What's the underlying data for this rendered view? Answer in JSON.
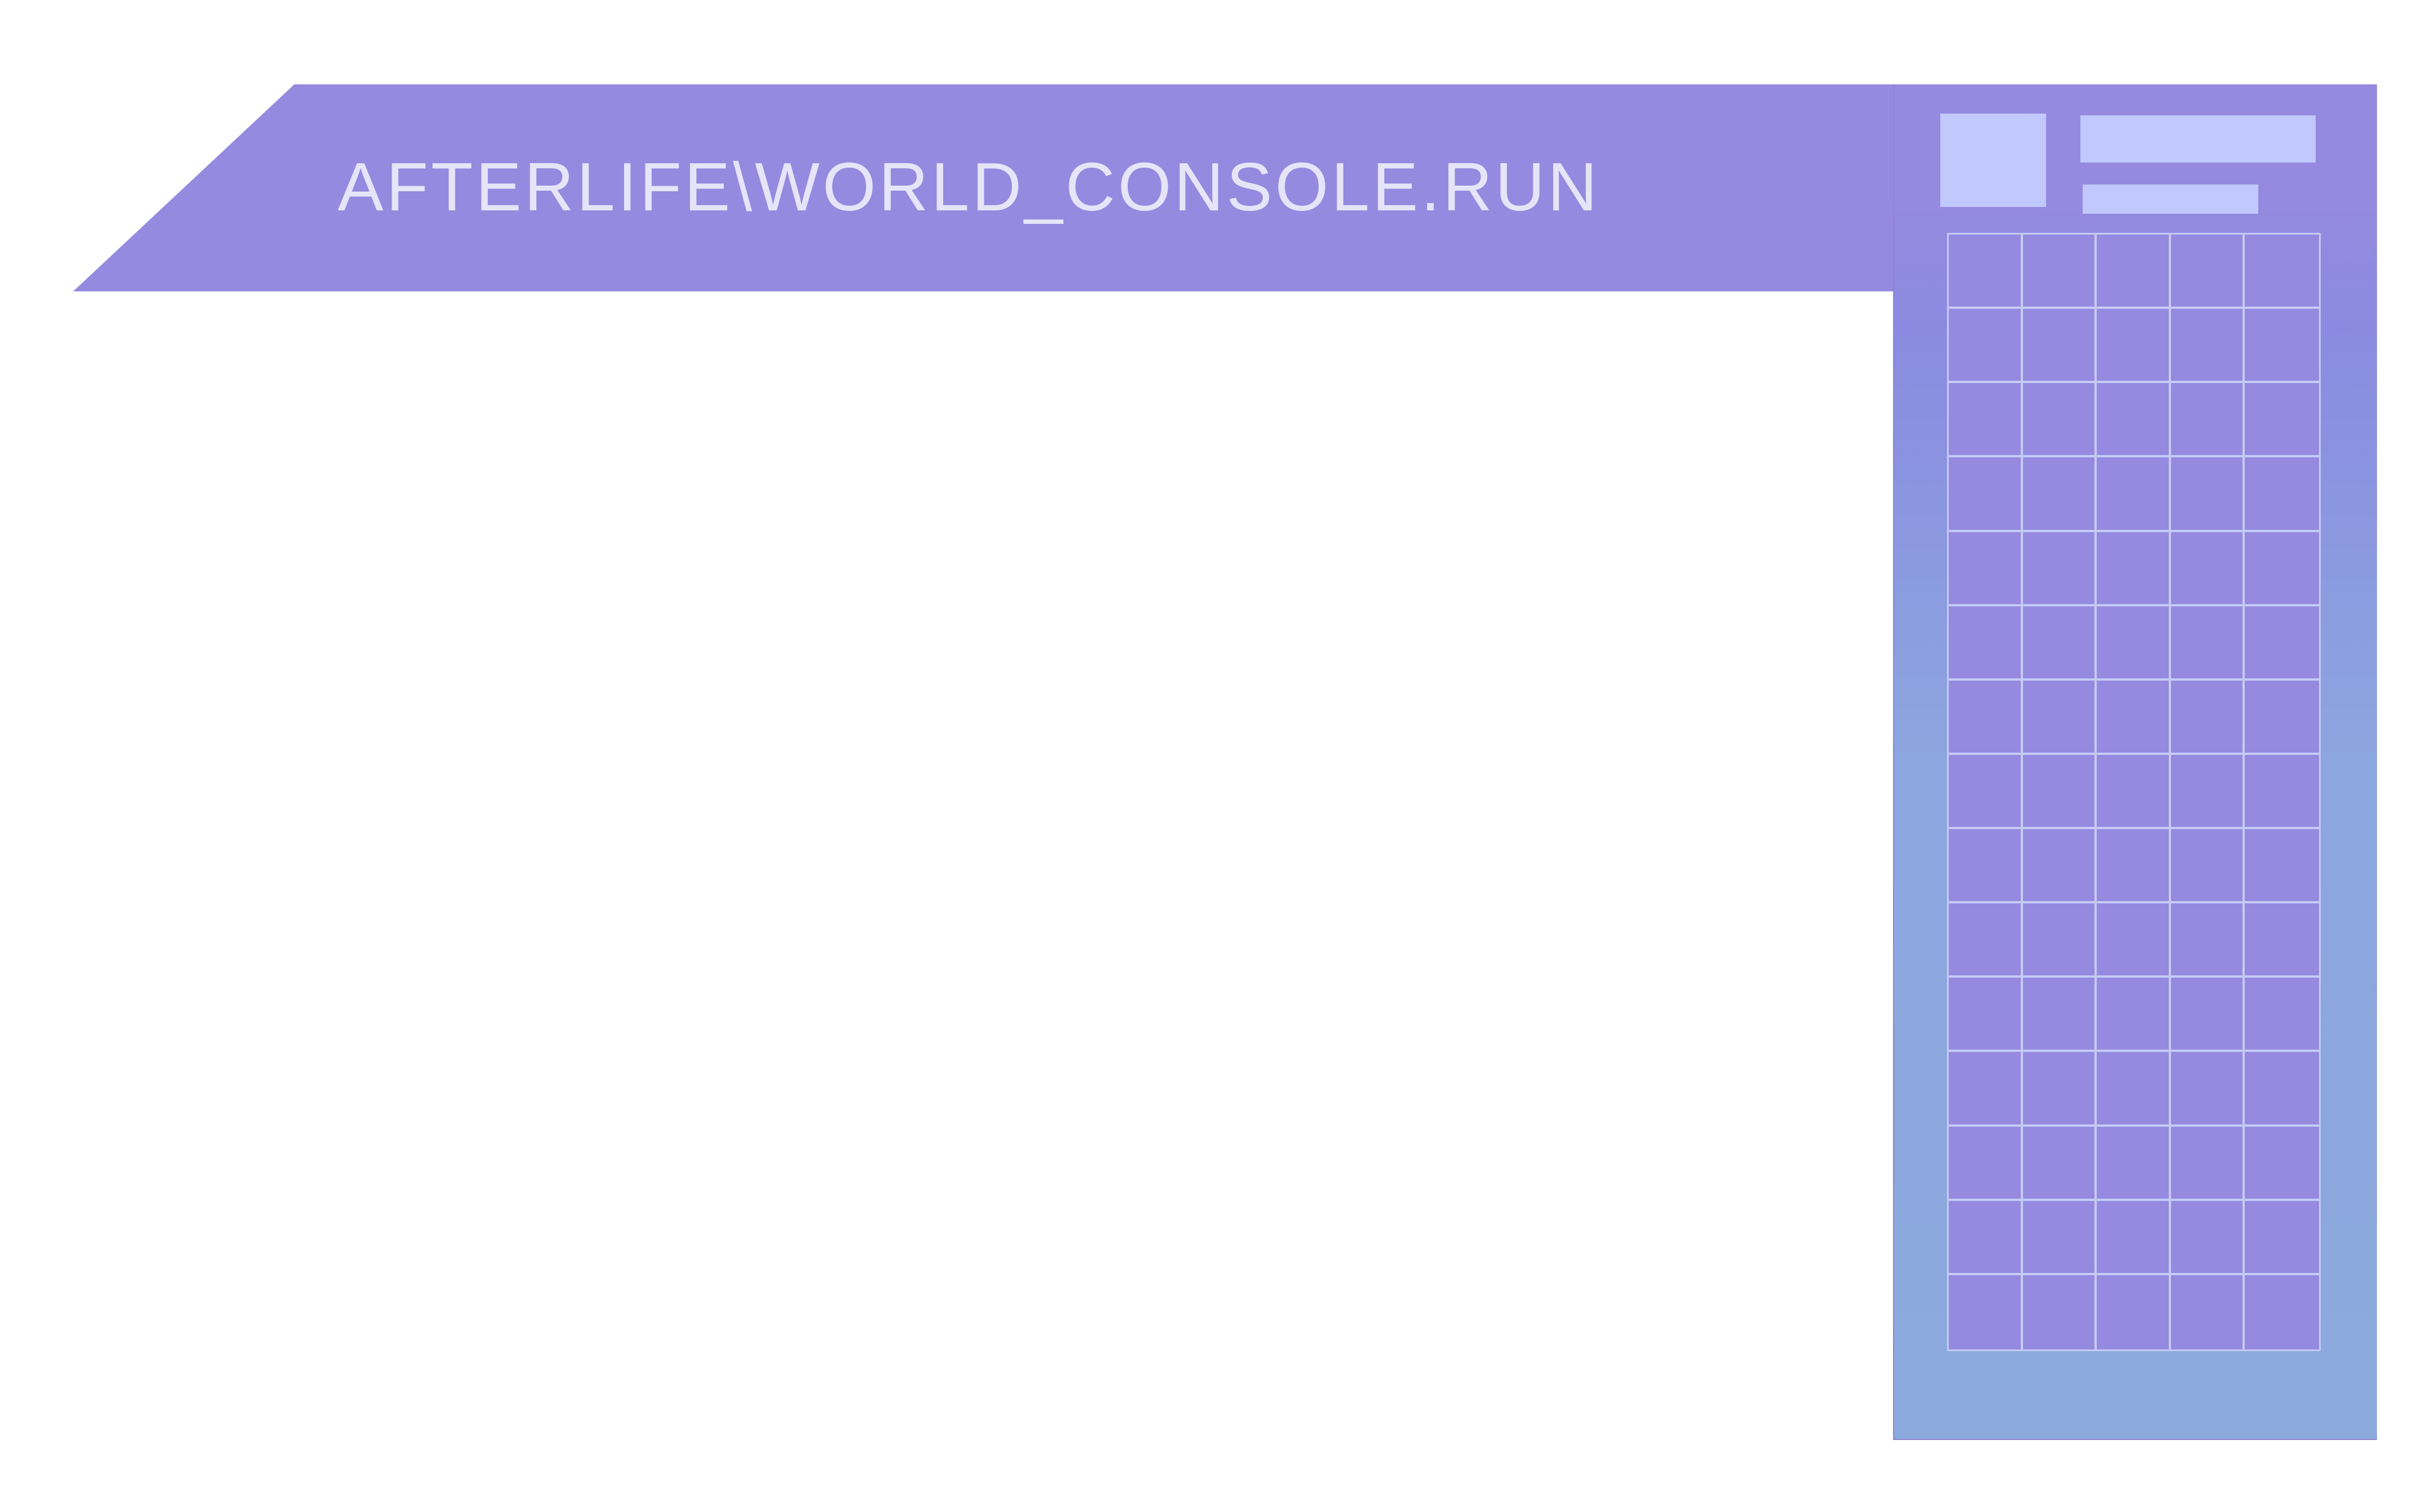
{
  "header": {
    "title": "AFTERLIFE\\WORLD_CONSOLE.RUN"
  },
  "colors": {
    "banner": "#958adf",
    "panel_top": "#958adf",
    "panel_bottom": "#8caade",
    "accent_light": "#c0c8fc",
    "grid_line": "#c6cbf6",
    "title_text": "#e6e4f8"
  },
  "side_panel": {
    "grid": {
      "columns": 5,
      "rows": 15
    }
  }
}
